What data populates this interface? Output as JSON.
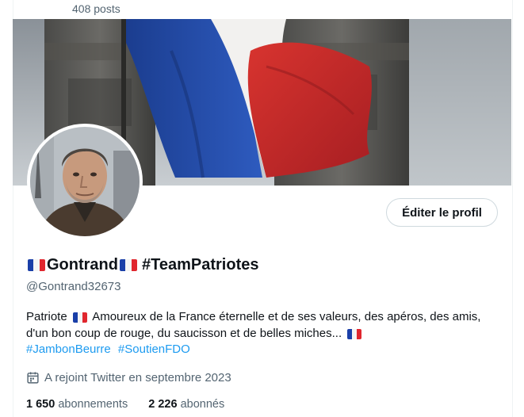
{
  "header": {
    "posts_count": "408 posts"
  },
  "profile": {
    "display_name_part1": "Gontrand",
    "display_name_part2": "#TeamPatriotes",
    "handle": "@Gontrand32673",
    "edit_button_label": "Éditer le profil",
    "bio_part1": "Patriote",
    "bio_part2": "Amoureux de la France éternelle et de ses valeurs, des apéros, des amis, d'un bon coup de rouge, du saucisson et de belles miches...",
    "hashtags": [
      "#JambonBeurre",
      "#SoutienFDO"
    ],
    "joined": "A rejoint Twitter en septembre 2023",
    "following_count": "1 650",
    "following_label": "abonnements",
    "followers_count": "2 226",
    "followers_label": "abonnés"
  },
  "icons": {
    "calendar": "calendar-icon",
    "flag": "french-flag-icon"
  },
  "colors": {
    "link": "#1d9bf0",
    "secondary_text": "#536471",
    "flag_blue": "#1a3fa8",
    "flag_red": "#e0262e"
  }
}
